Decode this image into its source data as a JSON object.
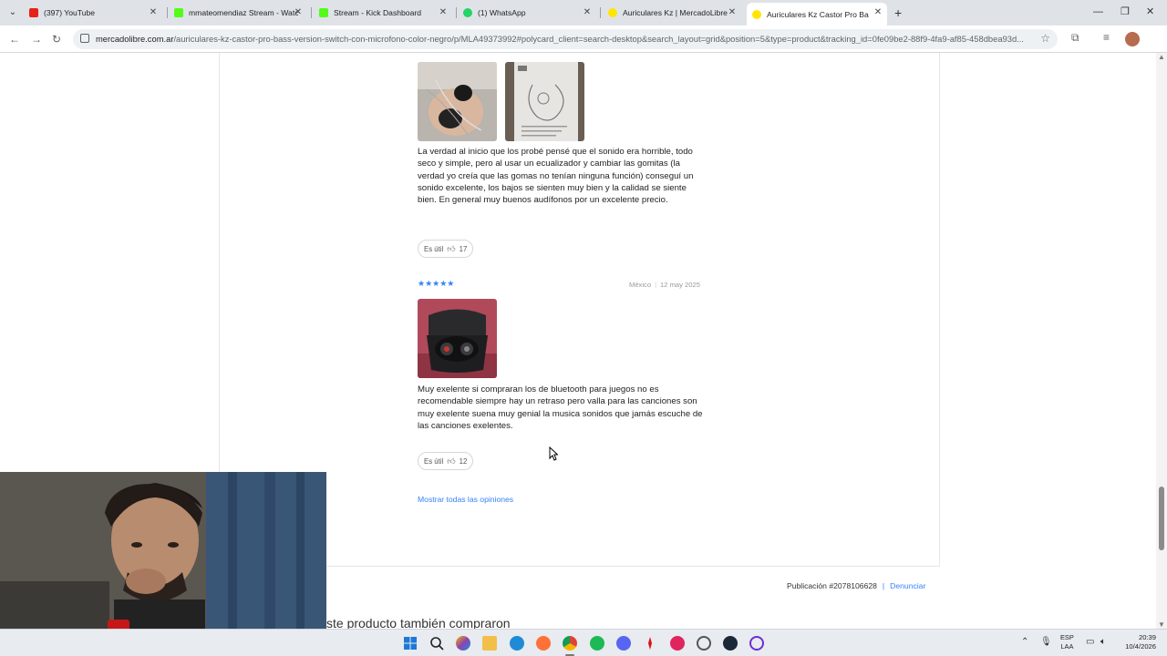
{
  "browser": {
    "tabs": [
      {
        "label": "(397) YouTube",
        "color": "#e62117",
        "active": false
      },
      {
        "label": "mmateomendiaz Stream - Watch",
        "color": "#53fc18",
        "active": false
      },
      {
        "label": "Stream - Kick Dashboard",
        "color": "#53fc18",
        "active": false
      },
      {
        "label": "(1) WhatsApp",
        "color": "#25d366",
        "active": false
      },
      {
        "label": "Auriculares Kz | MercadoLibre",
        "color": "#ffe600",
        "active": false
      },
      {
        "label": "Auriculares Kz Castor Pro Bass",
        "color": "#ffe600",
        "active": true
      }
    ],
    "url_host": "mercadolibre.com.ar",
    "url_path": "/auriculares-kz-castor-pro-bass-version-switch-con-microfono-color-negro/p/MLA49373992#polycard_client=search-desktop&search_layout=grid&position=5&type=product&tracking_id=0fe09be2-88f9-4fa9-af85-458dbea93d..."
  },
  "reviews": [
    {
      "text": "La verdad al inicio que los probé pensé que el sonido era horrible, todo seco y simple, pero al usar un ecualizador y cambiar las gomitas (la verdad yo creía que las gomas no tenían ninguna función) conseguí un sonido excelente, los bajos se sienten muy bien y la calidad se siente bien. En general muy buenos audífonos por un excelente precio.",
      "useful_label": "Es útil",
      "useful_count": "17"
    },
    {
      "stars": "★★★★★",
      "country": "México",
      "date": "12 may 2025",
      "text": "Muy exelente si compraran los de bluetooth para juegos no es recomendable siempre hay un retraso pero valla para las canciones son muy exelente suena muy genial la musica sonidos que jamás escuche de las canciones exelentes.",
      "useful_label": "Es útil",
      "useful_count": "12"
    }
  ],
  "show_all_label": "Mostrar todas las opiniones",
  "publication": "Publicación #2078106628",
  "report_label": "Denunciar",
  "related_heading": "ste producto también compraron",
  "taskbar": {
    "lang_line1": "ESP",
    "lang_line2": "LAA",
    "time": "20:39",
    "date": "10/4/2026"
  },
  "colors": {
    "accent": "#3483fa",
    "meli_yellow": "#ffe600"
  }
}
